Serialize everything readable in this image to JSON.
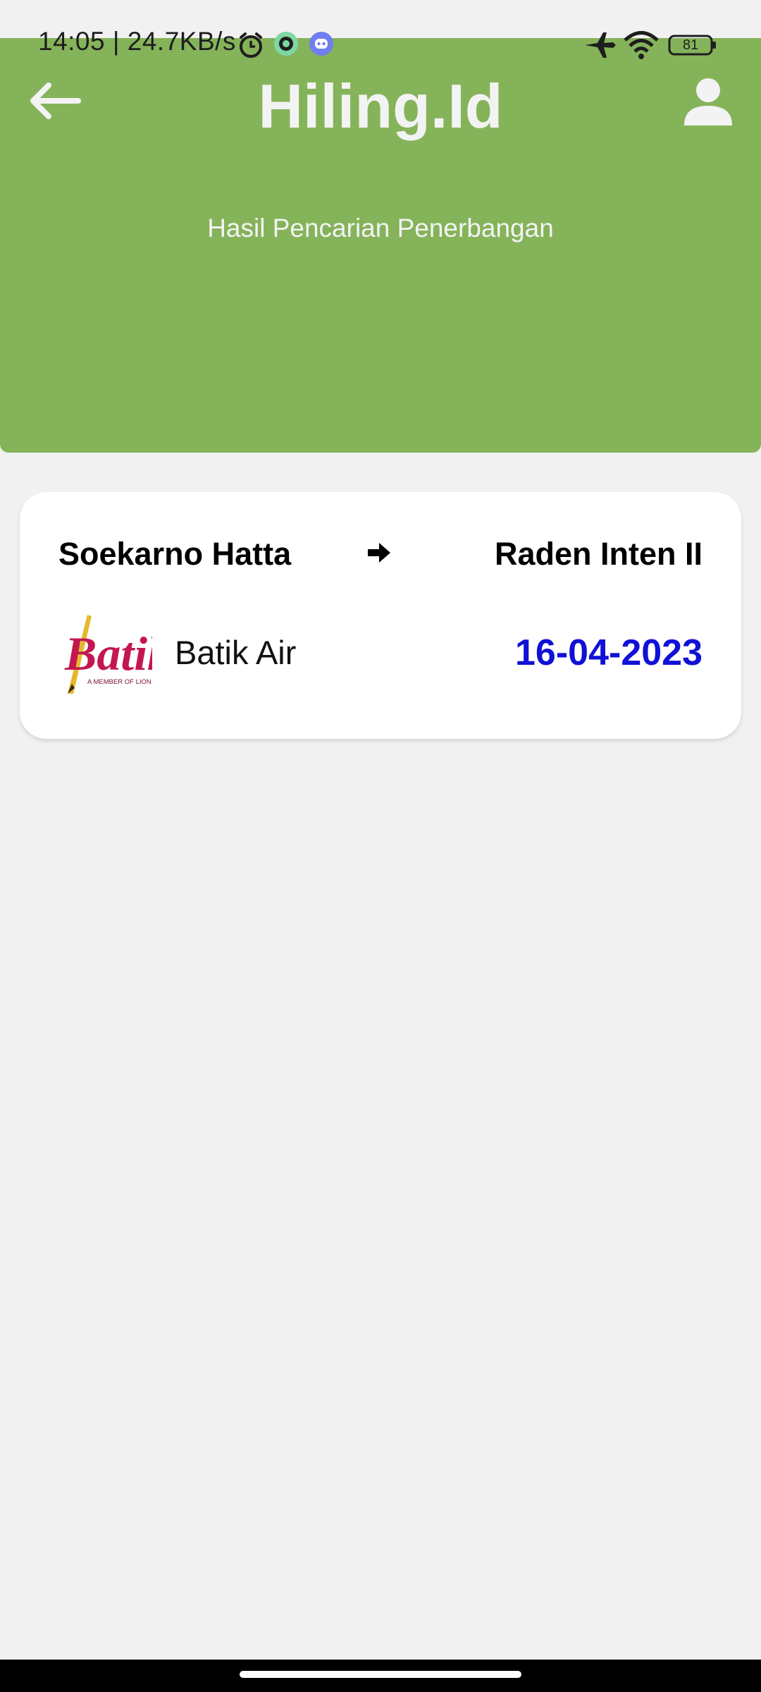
{
  "status_bar": {
    "time_speed": "14:05 | 24.7KB/s",
    "battery": "81",
    "icons": [
      "alarm-icon",
      "chat-app-icon",
      "discord-icon",
      "airplane-mode-icon",
      "wifi-icon",
      "battery-icon"
    ]
  },
  "header": {
    "app_title": "Hiling.Id",
    "subtitle": "Hasil Pencarian Penerbangan",
    "back_icon": "arrow-left-icon",
    "profile_icon": "person-icon",
    "color": "#85b35a"
  },
  "flight": {
    "origin": "Soekarno Hatta",
    "destination": "Raden Inten II",
    "airline": "Batik Air",
    "logo_text": "Batik",
    "logo_tagline": "A MEMBER OF LION GROUP",
    "date": "16-04-2023",
    "date_color": "#1010d6"
  }
}
